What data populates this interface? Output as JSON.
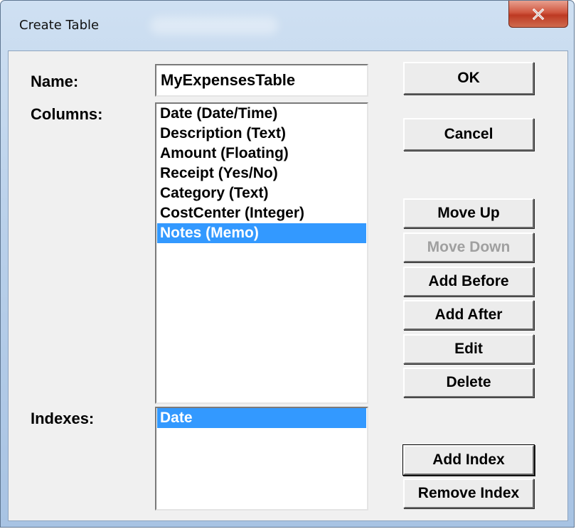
{
  "window": {
    "title": "Create Table"
  },
  "name": {
    "label": "Name:",
    "value": "MyExpensesTable"
  },
  "columns": {
    "label": "Columns:",
    "items": [
      "Date (Date/Time)",
      "Description (Text)",
      "Amount (Floating)",
      "Receipt (Yes/No)",
      "Category (Text)",
      "CostCenter (Integer)",
      "Notes (Memo)"
    ],
    "selected": "Notes (Memo)"
  },
  "indexes": {
    "label": "Indexes:",
    "items": [
      "Date"
    ],
    "selected": "Date"
  },
  "buttons": {
    "ok": "OK",
    "cancel": "Cancel",
    "move_up": "Move Up",
    "move_down": "Move Down",
    "add_before": "Add Before",
    "add_after": "Add After",
    "edit": "Edit",
    "delete": "Delete",
    "add_index": "Add Index",
    "remove_index": "Remove Index"
  },
  "states": {
    "move_down_enabled": false
  },
  "colors": {
    "selection": "#3399ff",
    "dialog_face": "#f0f0f0",
    "close_button": "#c8462f"
  },
  "icons": {
    "close": "close-icon"
  }
}
